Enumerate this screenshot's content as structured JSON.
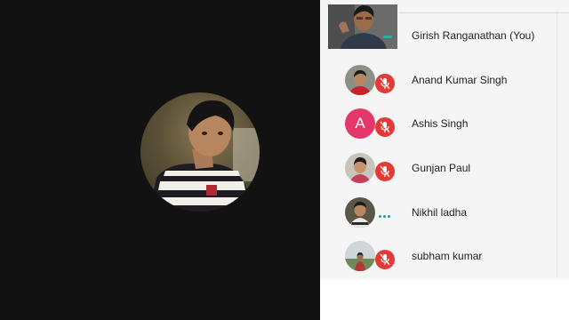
{
  "meeting": {
    "active_speaker": {
      "avatar_icon": "person-photo-avatar"
    },
    "participants": [
      {
        "name": "Girish Ranganathan (You)",
        "status": "video-on",
        "avatar": "self-video"
      },
      {
        "name": "Anand Kumar Singh",
        "status": "muted",
        "avatar": "photo"
      },
      {
        "name": "Ashis Singh",
        "status": "muted",
        "avatar": "letter",
        "initial": "A"
      },
      {
        "name": "Gunjan Paul",
        "status": "muted",
        "avatar": "photo"
      },
      {
        "name": "Nikhil ladha",
        "status": "speaking",
        "avatar": "photo"
      },
      {
        "name": "subham kumar",
        "status": "muted",
        "avatar": "photo"
      }
    ]
  },
  "colors": {
    "stage_bg": "#121212",
    "panel_bg": "#f5f5f5",
    "mute_red": "#e53935",
    "speaking_teal": "#12a4a0",
    "letter_avatar_pink": "#e5386a"
  }
}
